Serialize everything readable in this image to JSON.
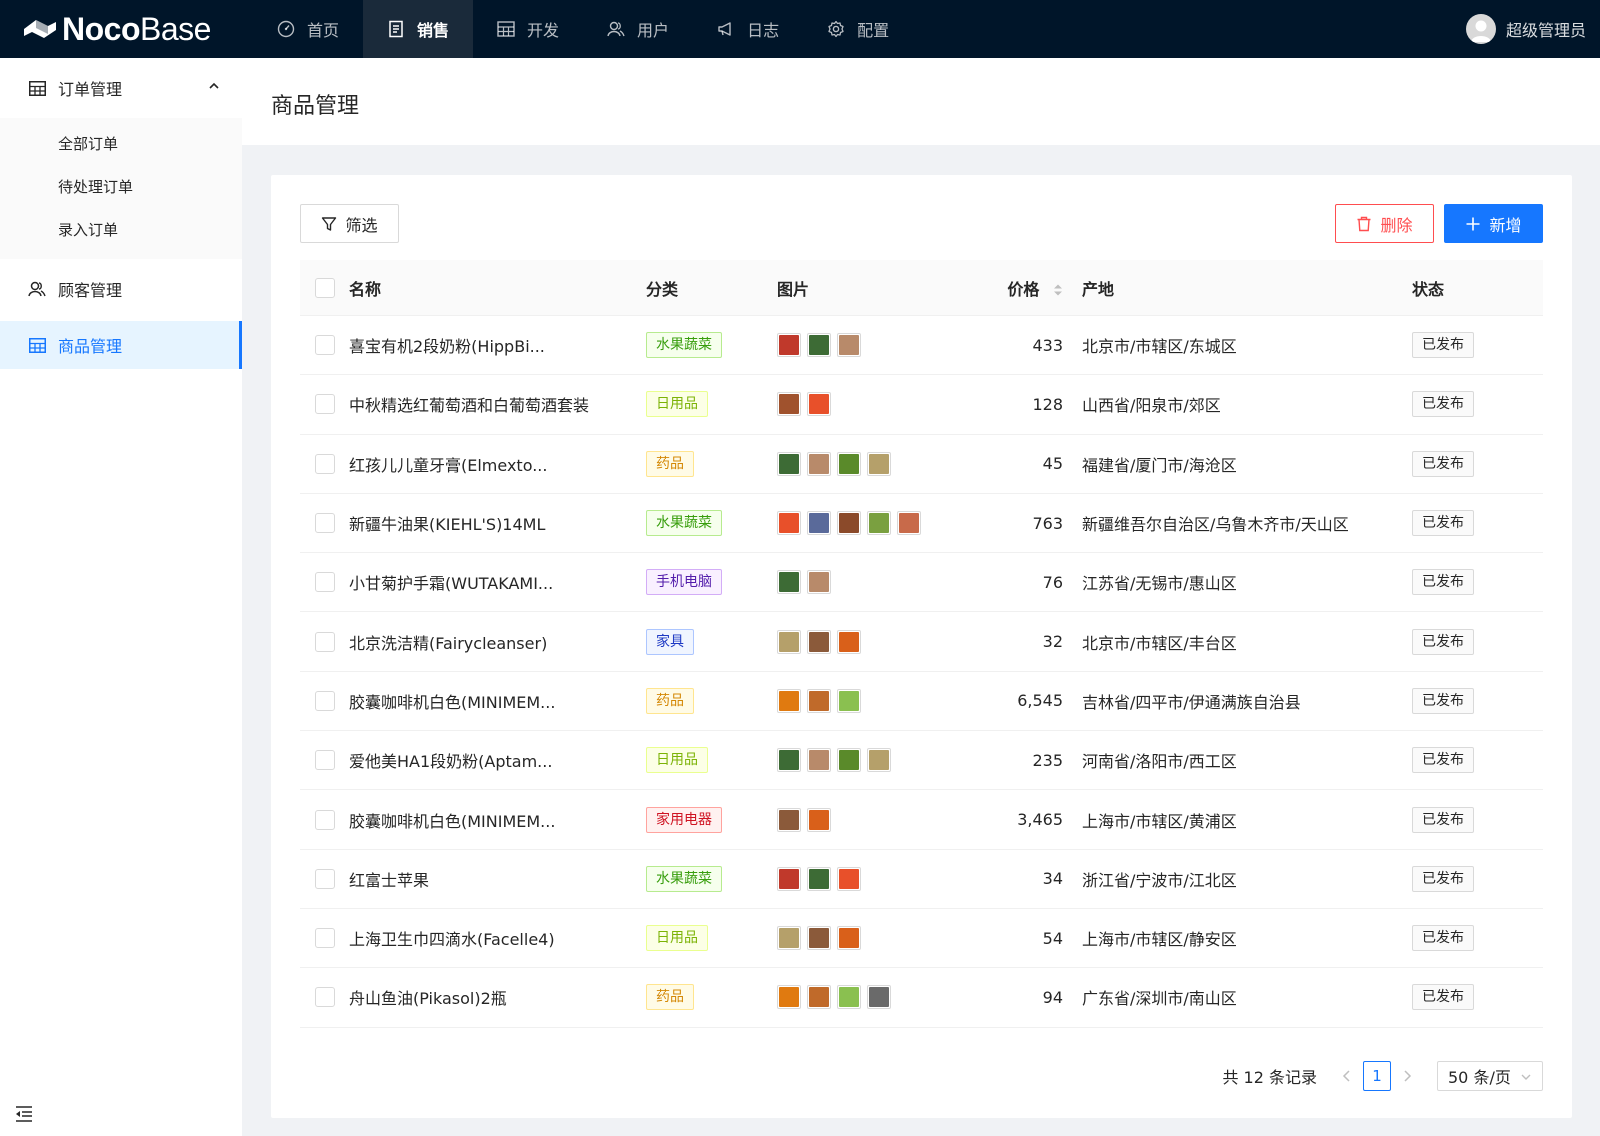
{
  "app": {
    "brand_bold": "Noco",
    "brand_light": "Base",
    "nav": [
      {
        "label": "首页",
        "icon": "dashboard-icon"
      },
      {
        "label": "销售",
        "icon": "document-icon",
        "active": true
      },
      {
        "label": "开发",
        "icon": "table-icon"
      },
      {
        "label": "用户",
        "icon": "users-icon"
      },
      {
        "label": "日志",
        "icon": "megaphone-icon"
      },
      {
        "label": "配置",
        "icon": "gear-icon"
      }
    ],
    "user_name": "超级管理员"
  },
  "sidebar": {
    "order_group": "订单管理",
    "order_sub": [
      "全部订单",
      "待处理订单",
      "录入订单"
    ],
    "customers": "顾客管理",
    "products": "商品管理"
  },
  "page": {
    "title": "商品管理"
  },
  "toolbar": {
    "filter_label": "筛选",
    "delete_label": "删除",
    "add_label": "新增"
  },
  "table": {
    "headers": {
      "name": "名称",
      "category": "分类",
      "images": "图片",
      "price": "价格",
      "origin": "产地",
      "status": "状态"
    },
    "rows": [
      {
        "name": "喜宝有机2段奶粉(HippBi...",
        "category": "水果蔬菜",
        "cat_color": "green",
        "images": [
          "#c0392b",
          "#3d6b35",
          "#b88a6a"
        ],
        "price": "433",
        "origin": "北京市/市辖区/东城区",
        "status": "已发布"
      },
      {
        "name": "中秋精选红葡萄酒和白葡萄酒套装",
        "category": "日用品",
        "cat_color": "lime",
        "images": [
          "#a0522d",
          "#e8502a"
        ],
        "price": "128",
        "origin": "山西省/阳泉市/郊区",
        "status": "已发布"
      },
      {
        "name": "红孩儿儿童牙膏(Elmexto...",
        "category": "药品",
        "cat_color": "gold",
        "images": [
          "#3d6b35",
          "#b88a6a",
          "#5a8a2a",
          "#b5a06a"
        ],
        "price": "45",
        "origin": "福建省/厦门市/海沧区",
        "status": "已发布"
      },
      {
        "name": "新疆牛油果(KIEHL'S)14ML",
        "category": "水果蔬菜",
        "cat_color": "green",
        "images": [
          "#e8502a",
          "#5a6a9a",
          "#8b4a2a",
          "#7aa040",
          "#c86a4a"
        ],
        "price": "763",
        "origin": "新疆维吾尔自治区/乌鲁木齐市/天山区",
        "status": "已发布"
      },
      {
        "name": "小甘菊护手霜(WUTAKAMI...",
        "category": "手机电脑",
        "cat_color": "purple",
        "images": [
          "#3d6b35",
          "#b88a6a"
        ],
        "price": "76",
        "origin": "江苏省/无锡市/惠山区",
        "status": "已发布"
      },
      {
        "name": "北京洗洁精(Fairycleanser)",
        "category": "家具",
        "cat_color": "blue",
        "images": [
          "#b5a06a",
          "#8b5a3a",
          "#d9601a"
        ],
        "price": "32",
        "origin": "北京市/市辖区/丰台区",
        "status": "已发布"
      },
      {
        "name": "胶囊咖啡机白色(MINIMEM...",
        "category": "药品",
        "cat_color": "gold",
        "images": [
          "#e07a10",
          "#c06a2a",
          "#8ac050"
        ],
        "price": "6,545",
        "origin": "吉林省/四平市/伊通满族自治县",
        "status": "已发布"
      },
      {
        "name": "爱他美HA1段奶粉(Aptam...",
        "category": "日用品",
        "cat_color": "lime",
        "images": [
          "#3d6b35",
          "#b88a6a",
          "#5a8a2a",
          "#b5a06a"
        ],
        "price": "235",
        "origin": "河南省/洛阳市/西工区",
        "status": "已发布"
      },
      {
        "name": "胶囊咖啡机白色(MINIMEM...",
        "category": "家用电器",
        "cat_color": "red",
        "images": [
          "#8b5a3a",
          "#d9601a"
        ],
        "price": "3,465",
        "origin": "上海市/市辖区/黄浦区",
        "status": "已发布"
      },
      {
        "name": "红富士苹果",
        "category": "水果蔬菜",
        "cat_color": "green",
        "images": [
          "#c0392b",
          "#3d6b35",
          "#e8502a"
        ],
        "price": "34",
        "origin": "浙江省/宁波市/江北区",
        "status": "已发布"
      },
      {
        "name": "上海卫生巾四滴水(Facelle4)",
        "category": "日用品",
        "cat_color": "lime",
        "images": [
          "#b5a06a",
          "#8b5a3a",
          "#d9601a"
        ],
        "price": "54",
        "origin": "上海市/市辖区/静安区",
        "status": "已发布"
      },
      {
        "name": "舟山鱼油(Pikasol)2瓶",
        "category": "药品",
        "cat_color": "gold",
        "images": [
          "#e07a10",
          "#c06a2a",
          "#8ac050",
          "#6a6a6a"
        ],
        "price": "94",
        "origin": "广东省/深圳市/南山区",
        "status": "已发布"
      }
    ]
  },
  "pagination": {
    "total_text": "共 12 条记录",
    "current_page": "1",
    "page_size": "50 条/页"
  },
  "colors": {
    "primary": "#1677ff",
    "danger": "#ff4d4f",
    "header_bg": "#001529",
    "tag_styles": {
      "green": {
        "color": "#389e0d",
        "bg": "#f6ffed",
        "border": "#b7eb8f"
      },
      "lime": {
        "color": "#7cb305",
        "bg": "#fcffe6",
        "border": "#eaff8f"
      },
      "gold": {
        "color": "#d48806",
        "bg": "#fffbe6",
        "border": "#ffe58f"
      },
      "purple": {
        "color": "#531dab",
        "bg": "#f9f0ff",
        "border": "#d3adf7"
      },
      "blue": {
        "color": "#1d39c4",
        "bg": "#f0f5ff",
        "border": "#adc6ff"
      },
      "red": {
        "color": "#cf1322",
        "bg": "#fff1f0",
        "border": "#ffa39e"
      }
    }
  }
}
